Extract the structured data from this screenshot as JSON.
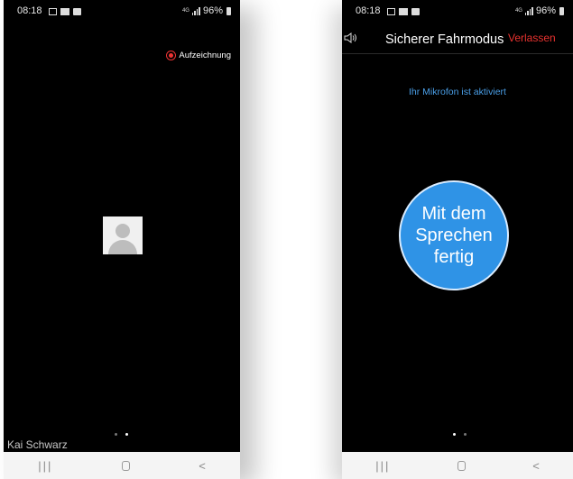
{
  "left_screen": {
    "status_time": "08:18",
    "status_signal": "4G",
    "status_battery": "96%",
    "recording_label": "Aufzeichnung",
    "participant_name": "Kai Schwarz"
  },
  "right_screen": {
    "status_time": "08:18",
    "status_signal": "4G",
    "status_battery": "96%",
    "title": "Sicherer Fahrmodus",
    "leave_label": "Verlassen",
    "mic_status": "Ihr Mikrofon ist aktiviert",
    "done_speaking_label": "Mit dem Sprechen fertig"
  },
  "navbar": {
    "recent": "|||",
    "back": "<"
  },
  "colors": {
    "accent_blue": "#2f93e6",
    "leave_red": "#e8322f",
    "recording_red": "#ee3333"
  }
}
